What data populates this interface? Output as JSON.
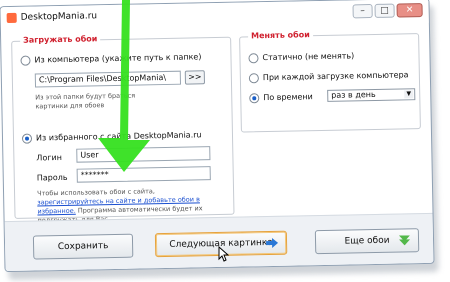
{
  "window": {
    "title": "DesktopMania.ru",
    "app_icon": "app-logo-icon",
    "buttons": {
      "minimize": "–",
      "maximize": "□",
      "close": "✕"
    }
  },
  "load_group": {
    "legend": "Загружать обои",
    "from_computer": {
      "label": "Из компьютера (укажите путь к папке)",
      "selected": false,
      "path_value": "C:\\Program Files\\DesktopMania\\",
      "browse_label": ">>",
      "hint": "Из этой папки будут браться картинки для обоев"
    },
    "from_favorites": {
      "label": "Из избранного с сайта DesktopMania.ru",
      "selected": true,
      "login_label": "Логин",
      "login_value": "User",
      "password_label": "Пароль",
      "password_value": "*******",
      "note_start": "Чтобы использовать обои с сайта,",
      "note_link": "зарегистрируйтесь на сайте и добавьте обои в избранное.",
      "note_end": "Программа автоматически будет их подгружать для Вас."
    }
  },
  "change_group": {
    "legend": "Менять обои",
    "options": [
      {
        "label": "Статично (не менять)",
        "selected": false
      },
      {
        "label": "При каждой загрузке компьютера",
        "selected": false
      },
      {
        "label": "По времени",
        "selected": true
      }
    ],
    "interval_value": "раз в день"
  },
  "footer": {
    "save": "Сохранить",
    "next": "Следующая картинка",
    "more": "Еще обои"
  },
  "colors": {
    "legend": "#d0202e",
    "overlay_arrow": "#35e01f",
    "link": "#1a4fd0",
    "button_focus": "#e6a23c"
  },
  "icons": {
    "next_button_icon": "arrow-right-icon",
    "more_button_icon": "download-arrow-icon"
  }
}
